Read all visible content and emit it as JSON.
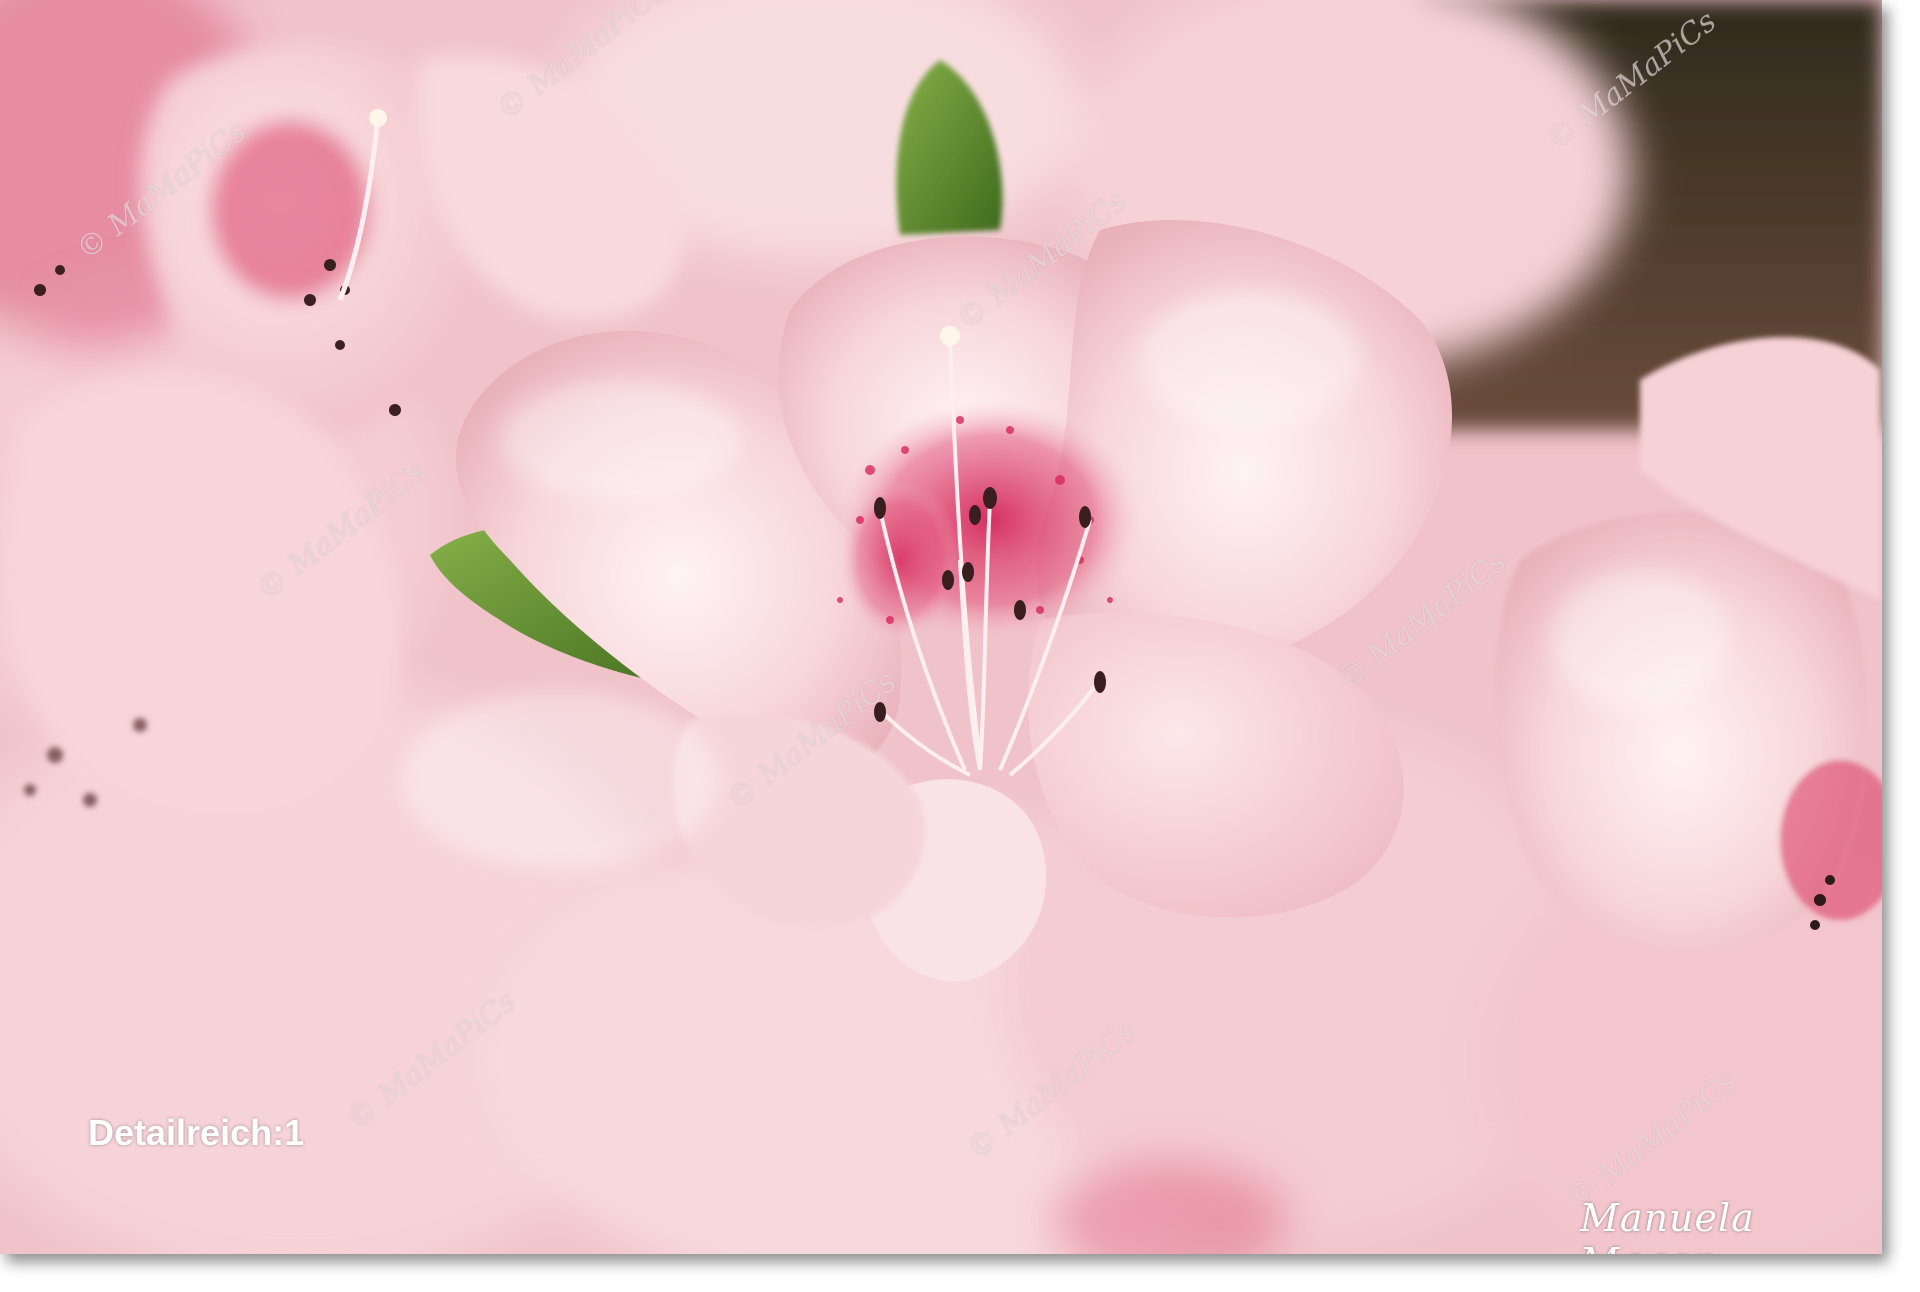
{
  "caption": "Detailreich:1",
  "signature": "Manuela Mager",
  "watermark": "© MaMaPiCs",
  "colors": {
    "petal_light": "#f9dfe2",
    "petal_mid": "#f2c3ca",
    "petal_deep": "#e6a3ae",
    "blotch": "#d8335f",
    "anther": "#4a2a2a",
    "leaf": "#5b8a2c",
    "background_dark": "#3b3222"
  }
}
